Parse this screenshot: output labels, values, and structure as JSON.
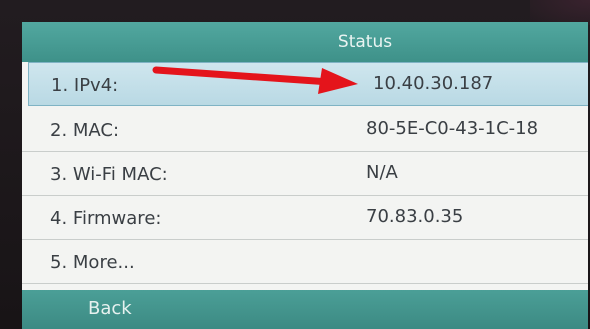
{
  "screen": {
    "title": "Status",
    "items": [
      {
        "label": "1. IPv4:",
        "value": "10.40.30.187"
      },
      {
        "label": "2. MAC:",
        "value": "80-5E-C0-43-1C-18"
      },
      {
        "label": "3. Wi-Fi MAC:",
        "value": "N/A"
      },
      {
        "label": "4. Firmware:",
        "value": "70.83.0.35"
      },
      {
        "label": "5. More...",
        "value": ""
      }
    ],
    "softkey_back": "Back"
  },
  "colors": {
    "accent": "#46988f",
    "selection": "#c3e0ea",
    "annotation_arrow": "#e4141b"
  },
  "annotation": {
    "icon": "red-arrow-icon",
    "points_to": "IPv4 value"
  }
}
